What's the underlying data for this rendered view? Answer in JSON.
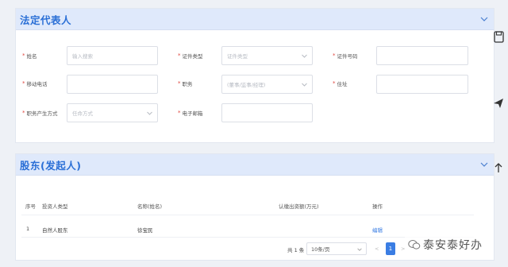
{
  "section1": {
    "title": "法定代表人",
    "fields": {
      "name": {
        "label": "姓名",
        "placeholder": "输入搜索"
      },
      "cert_type": {
        "label": "证件类型",
        "placeholder": "证件类型"
      },
      "cert_no": {
        "label": "证件号码",
        "value": ""
      },
      "mobile": {
        "label": "移动电话",
        "value": ""
      },
      "position": {
        "label": "职务",
        "placeholder": "(董事/监事/经理)"
      },
      "address": {
        "label": "住址",
        "value": ""
      },
      "method": {
        "label": "职务产生方式",
        "placeholder": "任命方式"
      },
      "email": {
        "label": "电子邮箱",
        "value": ""
      }
    }
  },
  "section2": {
    "title": "股东(发起人)",
    "table": {
      "columns": [
        "序号",
        "投资人类型",
        "名称(姓名)",
        "认缴出资额(万元)",
        "操作"
      ],
      "rows": [
        {
          "index": "1",
          "type": "自然人股东",
          "name": "徐宝民",
          "amount": "",
          "action": "编辑"
        }
      ]
    },
    "pagination": {
      "total": "共 1 条",
      "page_size": "10条/页",
      "prev": "<",
      "current": "1",
      "next": ">"
    }
  },
  "watermark": {
    "text": "泰安泰好办"
  },
  "colors": {
    "accent": "#3a7de3",
    "header_bg": "#dfe9fb",
    "required": "#e0473f"
  }
}
